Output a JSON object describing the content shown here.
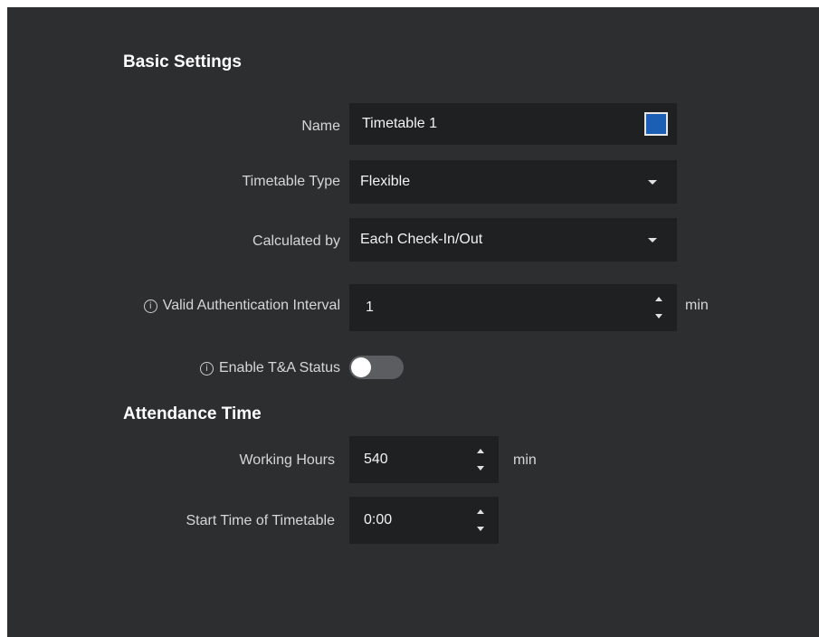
{
  "basic_settings": {
    "title": "Basic Settings",
    "name": {
      "label": "Name",
      "value": "Timetable 1",
      "color": "#1a5fb4"
    },
    "timetable_type": {
      "label": "Timetable Type",
      "value": "Flexible"
    },
    "calculated_by": {
      "label": "Calculated by",
      "value": "Each Check-In/Out"
    },
    "valid_auth_interval": {
      "label": "Valid Authentication Interval",
      "value": "1",
      "unit": "min",
      "info_icon": "info-icon"
    },
    "enable_ta_status": {
      "label": "Enable T&A Status",
      "enabled": false,
      "info_icon": "info-icon"
    }
  },
  "attendance_time": {
    "title": "Attendance Time",
    "working_hours": {
      "label": "Working Hours",
      "value": "540",
      "unit": "min"
    },
    "start_time": {
      "label": "Start Time of Timetable",
      "value": "0:00"
    }
  },
  "colors": {
    "panel_bg": "#2d2e30",
    "field_bg": "#1f2022",
    "accent": "#1a5fb4"
  }
}
